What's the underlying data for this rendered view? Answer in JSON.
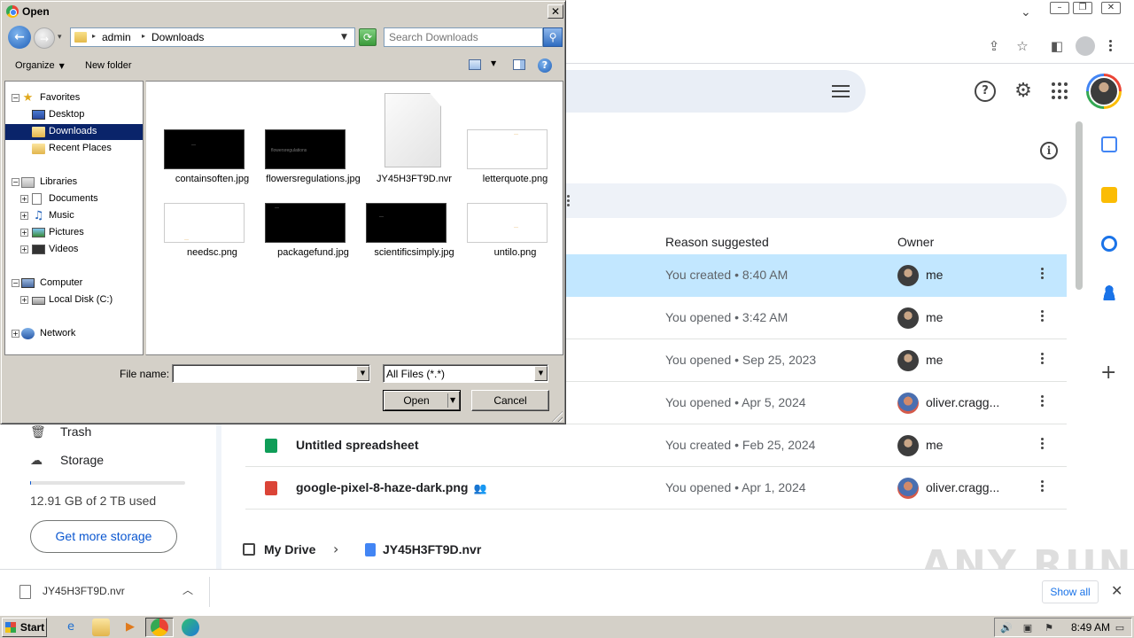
{
  "dialog": {
    "title": "Open",
    "address": {
      "crumbs": [
        "admin",
        "Downloads"
      ]
    },
    "search_placeholder": "Search Downloads",
    "toolbar": {
      "organize_label": "Organize",
      "new_folder_label": "New folder"
    },
    "nav_tree": [
      {
        "label": "Favorites",
        "icon": "star-icon",
        "level": 0,
        "expander": "−"
      },
      {
        "label": "Desktop",
        "icon": "desktop-icon",
        "level": 1
      },
      {
        "label": "Downloads",
        "icon": "downloads-folder-icon",
        "level": 1,
        "selected": true
      },
      {
        "label": "Recent Places",
        "icon": "recent-places-icon",
        "level": 1
      },
      {
        "label": "Libraries",
        "icon": "libraries-icon",
        "level": 0,
        "expander": "−"
      },
      {
        "label": "Documents",
        "icon": "documents-icon",
        "level": 1,
        "expander": "+"
      },
      {
        "label": "Music",
        "icon": "music-icon",
        "level": 1,
        "expander": "+"
      },
      {
        "label": "Pictures",
        "icon": "pictures-icon",
        "level": 1,
        "expander": "+"
      },
      {
        "label": "Videos",
        "icon": "videos-icon",
        "level": 1,
        "expander": "+"
      },
      {
        "label": "Computer",
        "icon": "computer-icon",
        "level": 0,
        "expander": "−"
      },
      {
        "label": "Local Disk (C:)",
        "icon": "disk-icon",
        "level": 1,
        "expander": "+"
      },
      {
        "label": "Network",
        "icon": "network-icon",
        "level": 0,
        "expander": "+"
      }
    ],
    "files": [
      {
        "name": "containsoften.jpg",
        "thumb": "dark"
      },
      {
        "name": "flowersregulations.jpg",
        "thumb": "dark",
        "mark": "flowersregulations"
      },
      {
        "name": "JY45H3FT9D.nvr",
        "thumb": "blank"
      },
      {
        "name": "letterquote.png",
        "thumb": "light"
      },
      {
        "name": "needsc.png",
        "thumb": "light"
      },
      {
        "name": "packagefund.jpg",
        "thumb": "dark"
      },
      {
        "name": "scientificsimply.jpg",
        "thumb": "dark"
      },
      {
        "name": "untilo.png",
        "thumb": "light"
      }
    ],
    "file_name_label": "File name:",
    "file_name_value": "",
    "filter_value": "All Files (*.*)",
    "open_label": "Open",
    "cancel_label": "Cancel"
  },
  "drive": {
    "columns": {
      "reason": "Reason suggested",
      "owner": "Owner"
    },
    "rows": [
      {
        "name": "",
        "reason": "You created • 8:40 AM",
        "owner": "me",
        "selected": true,
        "owner_avatar": "me"
      },
      {
        "name": "",
        "reason": "You opened • 3:42 AM",
        "owner": "me",
        "owner_avatar": "me"
      },
      {
        "name": "",
        "reason": "You opened • Sep 25, 2023",
        "owner": "me",
        "owner_avatar": "me"
      },
      {
        "name": "",
        "reason": "You opened • Apr 5, 2024",
        "owner": "oliver.cragg...",
        "owner_avatar": "other"
      },
      {
        "name": "Untitled spreadsheet",
        "reason": "You created • Feb 25, 2024",
        "owner": "me",
        "type": "sheets",
        "owner_avatar": "me"
      },
      {
        "name": "google-pixel-8-haze-dark.png",
        "reason": "You opened • Apr 1, 2024",
        "owner": "oliver.cragg...",
        "type": "image",
        "shared": true,
        "owner_avatar": "other"
      }
    ],
    "sidebar": {
      "trash_label": "Trash",
      "storage_label": "Storage",
      "storage_used_text": "12.91 GB of 2 TB used",
      "storage_fraction": 0.0065,
      "get_storage_label": "Get more storage"
    },
    "breadcrumb": {
      "root": "My Drive",
      "file": "JY45H3FT9D.nvr"
    }
  },
  "download_shelf": {
    "file_name": "JY45H3FT9D.nvr",
    "show_all_label": "Show all"
  },
  "taskbar": {
    "start_label": "Start",
    "clock": "8:49 AM"
  },
  "watermark": "ANY RUN"
}
